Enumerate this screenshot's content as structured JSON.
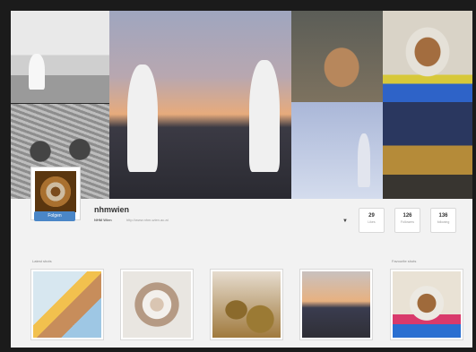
{
  "colors": {
    "follow_button": "#4a86c7",
    "page_bg": "#f2f2f2",
    "frame": "#1b1b1b"
  },
  "profile": {
    "username": "nhmwien",
    "full_name": "NHM Wien",
    "website": "http://www.nhm-wien.ac.at",
    "follow_label": "Folgen",
    "dropdown_icon": "caret-down-icon"
  },
  "stats": [
    {
      "value": "29",
      "label": "Likes"
    },
    {
      "value": "126",
      "label": "Followers"
    },
    {
      "value": "136",
      "label": "following"
    }
  ],
  "sections": {
    "left_label": "Latest shots",
    "right_label": "Favourite shots"
  }
}
